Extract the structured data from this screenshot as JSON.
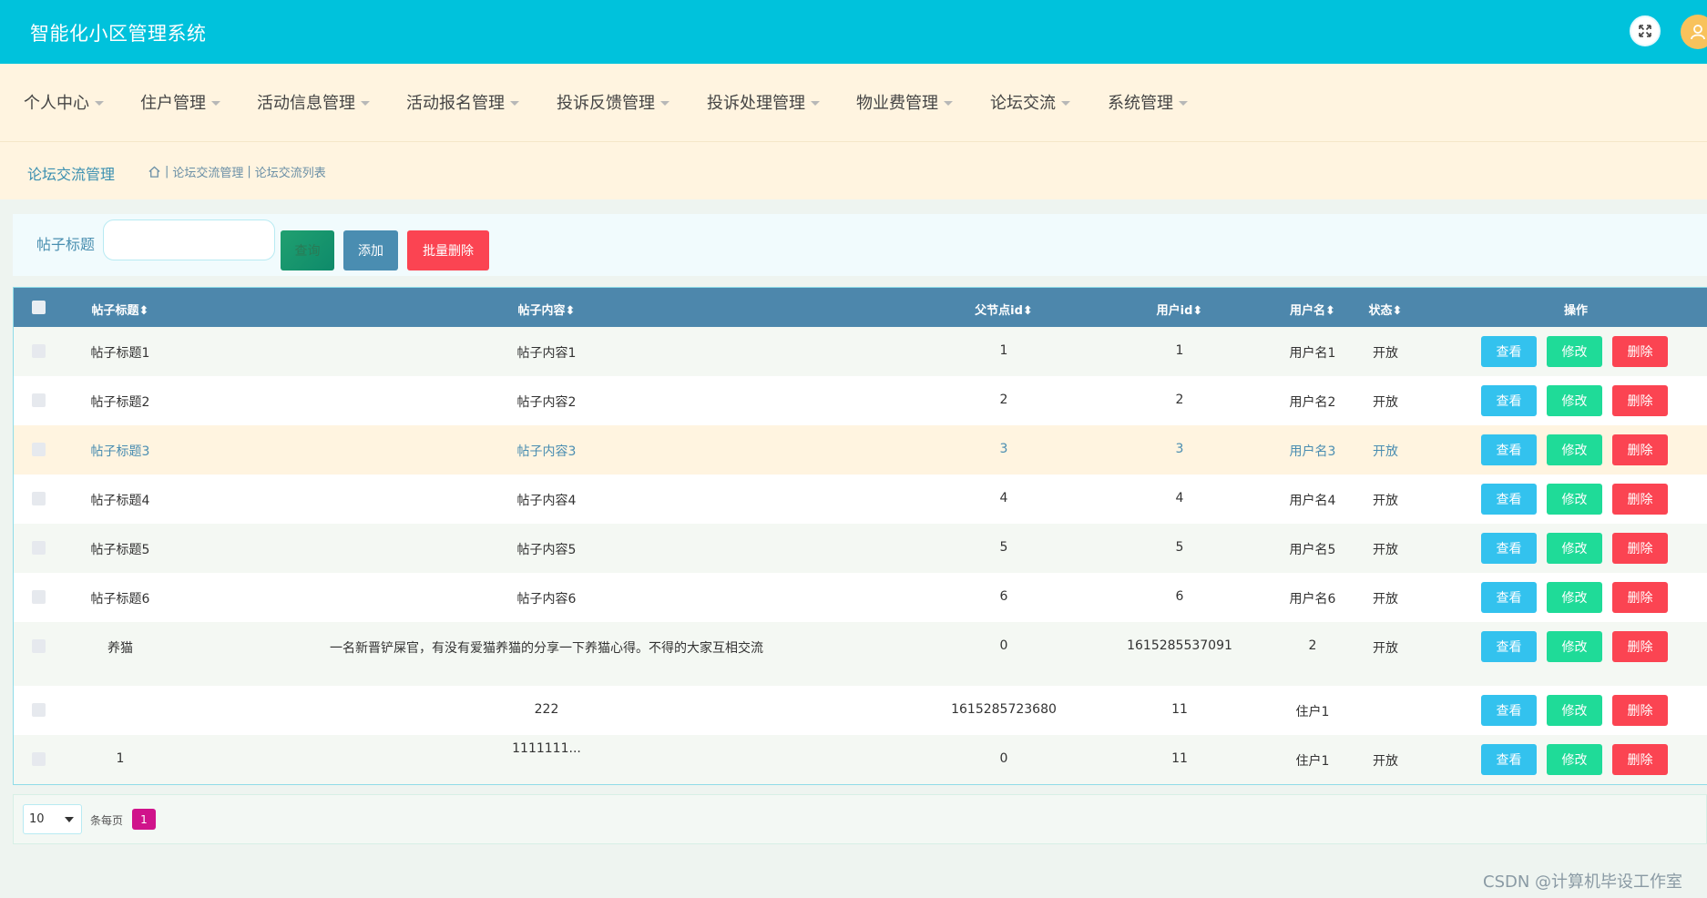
{
  "header": {
    "title": "智能化小区管理系统"
  },
  "nav": [
    {
      "label": "个人中心"
    },
    {
      "label": "住户管理"
    },
    {
      "label": "活动信息管理"
    },
    {
      "label": "活动报名管理"
    },
    {
      "label": "投诉反馈管理"
    },
    {
      "label": "投诉处理管理"
    },
    {
      "label": "物业费管理"
    },
    {
      "label": "论坛交流"
    },
    {
      "label": "系统管理"
    }
  ],
  "breadcrumb": {
    "title": "论坛交流管理",
    "path": "论坛交流管理",
    "current": "论坛交流列表",
    "sep": "|"
  },
  "search": {
    "label": "帖子标题",
    "value": "",
    "placeholder": "",
    "query_label": "查询",
    "add_label": "添加",
    "batch_delete_label": "批量删除"
  },
  "table": {
    "headers": {
      "title": "帖子标题",
      "content": "帖子内容",
      "parent": "父节点id",
      "userid": "用户id",
      "username": "用户名",
      "status": "状态",
      "actions": "操作"
    },
    "sort_glyph": "⬍",
    "action_labels": {
      "view": "查看",
      "edit": "修改",
      "delete": "删除"
    },
    "rows": [
      {
        "title": "帖子标题1",
        "content": "帖子内容1",
        "parent": "1",
        "userid": "1",
        "username": "用户名1",
        "status": "开放"
      },
      {
        "title": "帖子标题2",
        "content": "帖子内容2",
        "parent": "2",
        "userid": "2",
        "username": "用户名2",
        "status": "开放"
      },
      {
        "title": "帖子标题3",
        "content": "帖子内容3",
        "parent": "3",
        "userid": "3",
        "username": "用户名3",
        "status": "开放"
      },
      {
        "title": "帖子标题4",
        "content": "帖子内容4",
        "parent": "4",
        "userid": "4",
        "username": "用户名4",
        "status": "开放"
      },
      {
        "title": "帖子标题5",
        "content": "帖子内容5",
        "parent": "5",
        "userid": "5",
        "username": "用户名5",
        "status": "开放"
      },
      {
        "title": "帖子标题6",
        "content": "帖子内容6",
        "parent": "6",
        "userid": "6",
        "username": "用户名6",
        "status": "开放"
      },
      {
        "title": "养猫",
        "content": "一名新晋铲屎官，有没有爱猫养猫的分享一下养猫心得。不得的大家互相交流",
        "parent": "0",
        "userid": "1615285537091",
        "username": "2",
        "status": "开放"
      },
      {
        "title": "",
        "content": "222",
        "parent": "1615285723680",
        "userid": "11",
        "username": "住户1",
        "status": ""
      },
      {
        "title": "1",
        "content": "1111111...",
        "parent": "0",
        "userid": "11",
        "username": "住户1",
        "status": "开放"
      }
    ]
  },
  "pager": {
    "page_size": "10",
    "per_page_label": "条每页",
    "current_page": "1"
  },
  "watermark": "CSDN @计算机毕设工作室",
  "colors": {
    "header": "#00c2dc",
    "nav_bg": "#fff4e0",
    "table_header": "#4d87ac",
    "highlight_text": "#4a8db1",
    "view": "#33c2ee",
    "edit": "#1fdb98",
    "delete": "#fb4452",
    "page_active": "#d0138b"
  }
}
